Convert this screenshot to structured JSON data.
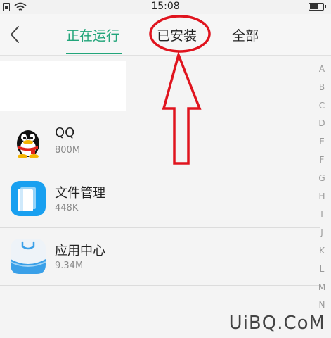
{
  "status_bar": {
    "time": "15:08"
  },
  "header": {
    "tabs": [
      {
        "label": "正在运行",
        "active": true
      },
      {
        "label": "已安装",
        "active": false
      },
      {
        "label": "全部",
        "active": false
      }
    ],
    "accent_color": "#22a57a"
  },
  "apps": [
    {
      "name": "QQ",
      "size": "800M",
      "icon": "qq-penguin-icon"
    },
    {
      "name": "文件管理",
      "size": "448K",
      "icon": "file-manager-icon"
    },
    {
      "name": "应用中心",
      "size": "9.34M",
      "icon": "app-center-icon"
    }
  ],
  "alphabet_index": [
    "A",
    "B",
    "C",
    "D",
    "E",
    "F",
    "G",
    "H",
    "I",
    "J",
    "K",
    "L",
    "M",
    "N"
  ],
  "annotation": {
    "color": "#e0141e"
  },
  "watermark": "UiBQ.CoM"
}
